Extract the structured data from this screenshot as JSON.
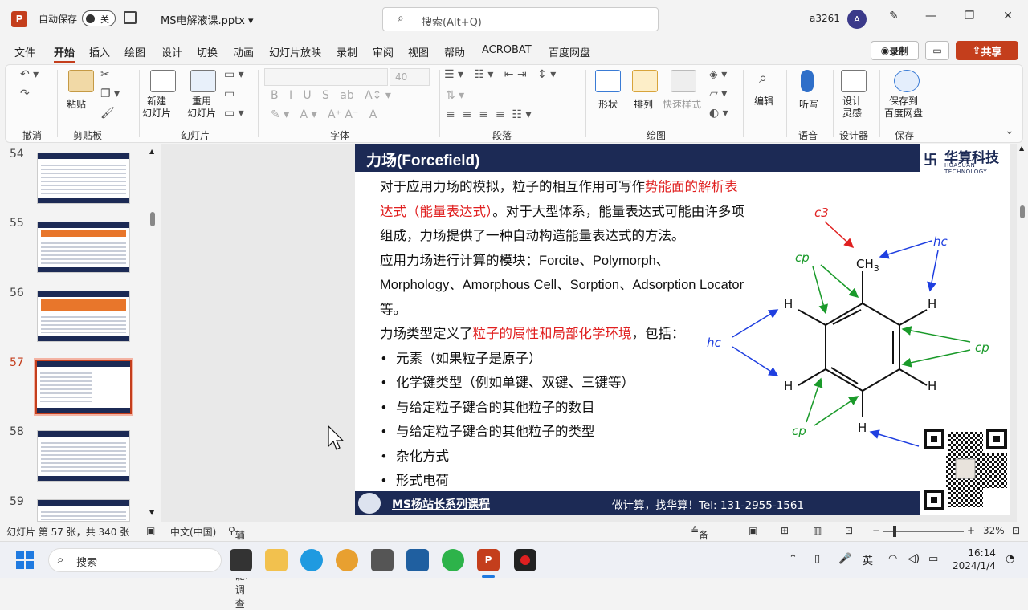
{
  "titlebar": {
    "autosave_label": "自动保存",
    "autosave_state": "关",
    "filename": "MS电解液课.pptx",
    "search_placeholder": "搜索(Alt+Q)",
    "user_name": "a3261",
    "avatar_letter": "A",
    "minimize": "—",
    "restore": "❐",
    "close": "✕"
  },
  "tabs": [
    "文件",
    "开始",
    "插入",
    "绘图",
    "设计",
    "切换",
    "动画",
    "幻灯片放映",
    "录制",
    "审阅",
    "视图",
    "帮助",
    "ACROBAT",
    "百度网盘"
  ],
  "active_tab": "开始",
  "actions": {
    "record": "录制",
    "share": "共享"
  },
  "ribbon": {
    "groups": [
      "撤消",
      "剪贴板",
      "幻灯片",
      "字体",
      "段落",
      "绘图",
      "语音",
      "设计器",
      "保存"
    ],
    "paste": "粘贴",
    "new_slide": "新建\n幻灯片",
    "reuse_slide": "重用\n幻灯片",
    "font_size": "40",
    "shape": "形状",
    "arrange": "排列",
    "quick_style": "快速样式",
    "edit": "编辑",
    "dictate": "听写",
    "designer": "设计\n灵感",
    "save_baidu": "保存到\n百度网盘"
  },
  "thumbnails": [
    {
      "num": "54"
    },
    {
      "num": "55"
    },
    {
      "num": "56"
    },
    {
      "num": "57"
    },
    {
      "num": "58"
    },
    {
      "num": "59"
    }
  ],
  "active_slide": "57",
  "slide": {
    "title": "力场(Forcefield)",
    "brand_name": "华算科技",
    "brand_sub": "HUASUAN TECHNOLOGY",
    "p1_a": "对于应用力场的模拟，粒子的相互作用可写作",
    "p1_red": "势能面的解析表达式（能量表达式）",
    "p1_b": "。对于大型体系，能量表达式可能由许多项组成，力场提供了一种自动构造能量表达式的方法。",
    "p2": "应用力场进行计算的模块：Forcite、Polymorph、Morphology、Amorphous Cell、Sorption、Adsorption Locator等。",
    "p3_a": "力场类型定义了",
    "p3_red": "粒子的属性和局部化学环境",
    "p3_b": "，包括：",
    "bullets": [
      "元素（如果粒子是原子）",
      "化学键类型（例如单键、双键、三键等）",
      "与给定粒子键合的其他粒子的数目",
      "与给定粒子键合的其他粒子的类型",
      "杂化方式",
      "形式电荷"
    ],
    "footer_left": "MS杨站长系列课程",
    "footer_right": "做计算，找华算！Tel: 131-2955-1561",
    "molecule": {
      "c3": "c3",
      "ch3": "CH",
      "ch3_sub": "3",
      "hc": "hc",
      "cp": "cp",
      "h": "H"
    }
  },
  "status": {
    "slide_info": "幻灯片 第 57 张，共 340 张",
    "lang": "中文(中国)",
    "accessibility": "辅助功能: 调查",
    "notes": "备注",
    "zoom": "32%"
  },
  "taskbar": {
    "search": "搜索",
    "time": "16:14",
    "date": "2024/1/4",
    "ime": "英"
  },
  "colors": {
    "accent": "#c43e1c",
    "slide_navy": "#1c2a55",
    "red_text": "#e02020"
  }
}
